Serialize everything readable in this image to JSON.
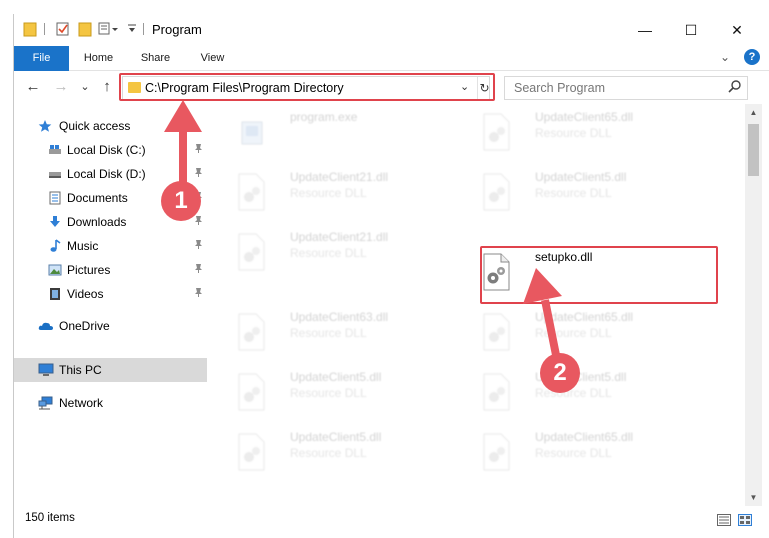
{
  "window": {
    "title": "Program",
    "controls": {
      "minimize": "—",
      "maximize": "☐",
      "close": "✕"
    }
  },
  "ribbon": {
    "tabs": [
      "File",
      "Home",
      "Share",
      "View"
    ],
    "expand_glyph": "⌄",
    "help_glyph": "?"
  },
  "nav": {
    "back": "←",
    "forward": "→",
    "recent": "⌄",
    "up": "↑"
  },
  "address": {
    "path": "C:\\Program Files\\Program Directory",
    "dropdown_glyph": "⌄",
    "refresh_glyph": "↻"
  },
  "search": {
    "placeholder": "Search Program",
    "icon": "search-icon"
  },
  "sidebar": {
    "items": [
      {
        "label": "Quick access",
        "icon": "star-icon",
        "pinned": false
      },
      {
        "label": "Local Disk (C:)",
        "icon": "drive-icon",
        "pinned": true
      },
      {
        "label": "Local Disk (D:)",
        "icon": "drive-icon",
        "pinned": true
      },
      {
        "label": "Documents",
        "icon": "documents-icon",
        "pinned": true
      },
      {
        "label": "Downloads",
        "icon": "downloads-icon",
        "pinned": true
      },
      {
        "label": "Music",
        "icon": "music-icon",
        "pinned": true
      },
      {
        "label": "Pictures",
        "icon": "pictures-icon",
        "pinned": true
      },
      {
        "label": "Videos",
        "icon": "videos-icon",
        "pinned": true
      },
      {
        "label": "OneDrive",
        "icon": "cloud-icon",
        "pinned": false
      },
      {
        "label": "This PC",
        "icon": "computer-icon",
        "pinned": false,
        "selected": true
      },
      {
        "label": "Network",
        "icon": "network-icon",
        "pinned": false
      }
    ],
    "pin_glyph": "📌"
  },
  "files": [
    {
      "name": "program.exe",
      "type": ""
    },
    {
      "name": "UpdateClient65.dll",
      "type": "Resource DLL"
    },
    {
      "name": "UpdateClient21.dll",
      "type": "Resource DLL"
    },
    {
      "name": "UpdateClient5.dll",
      "type": "Resource DLL"
    },
    {
      "name": "UpdateClient21.dll",
      "type": "Resource DLL"
    },
    {
      "name": "setupko.dll",
      "type": ""
    },
    {
      "name": "UpdateClient63.dll",
      "type": "Resource DLL"
    },
    {
      "name": "UpdateClient65.dll",
      "type": "Resource DLL"
    },
    {
      "name": "UpdateClient5.dll",
      "type": "Resource DLL"
    },
    {
      "name": "UpdateClient5.dll",
      "type": "Resource DLL"
    },
    {
      "name": "UpdateClient5.dll",
      "type": "Resource DLL"
    },
    {
      "name": "UpdateClient65.dll",
      "type": "Resource DLL"
    }
  ],
  "status": {
    "item_count": "150 items"
  },
  "annotations": {
    "step1": "1",
    "step2": "2"
  },
  "colors": {
    "accent": "#1a73c9",
    "highlight": "#e0434c",
    "marker": "#e85860"
  }
}
